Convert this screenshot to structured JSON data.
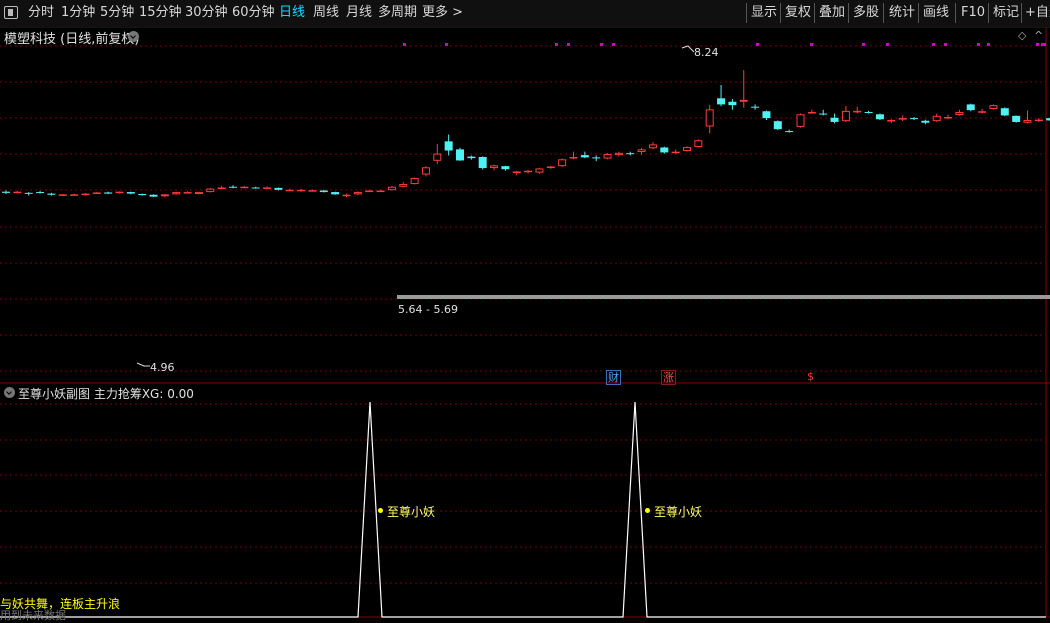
{
  "toolbar": {
    "periods": [
      {
        "label": "分时",
        "active": false
      },
      {
        "label": "1分钟",
        "active": false
      },
      {
        "label": "5分钟",
        "active": false
      },
      {
        "label": "15分钟",
        "active": false
      },
      {
        "label": "30分钟",
        "active": false
      },
      {
        "label": "60分钟",
        "active": false
      },
      {
        "label": "日线",
        "active": true
      },
      {
        "label": "周线",
        "active": false
      },
      {
        "label": "月线",
        "active": false
      },
      {
        "label": "多周期",
        "active": false
      },
      {
        "label": "更多 >",
        "active": false
      }
    ],
    "tools": [
      "显示",
      "复权",
      "叠加",
      "多股",
      "统计",
      "画线",
      "F10",
      "标记",
      "+自选"
    ]
  },
  "chart": {
    "title": "模塑科技 (日线,前复权)",
    "high_label": "8.24",
    "low_label": "4.96",
    "range_label": "5.64 - 5.69",
    "badges": [
      {
        "text": "财",
        "color": "#4aa8ff"
      },
      {
        "text": "涨",
        "color": "#ff5050"
      },
      {
        "text": "$",
        "color": "#ff3030"
      }
    ],
    "colors": {
      "up": "#ff3b3b",
      "down": "#4ef2f2",
      "grid": "#7a0000",
      "signal": "#ffffff"
    },
    "candles_approx_price": [
      {
        "o": 5.05,
        "c": 5.02,
        "h": 5.08,
        "l": 4.99
      },
      {
        "o": 5.03,
        "c": 5.05,
        "h": 5.07,
        "l": 5.0
      },
      {
        "o": 5.02,
        "c": 5.0,
        "h": 5.04,
        "l": 4.95
      },
      {
        "o": 5.04,
        "c": 5.02,
        "h": 5.07,
        "l": 5.0
      },
      {
        "o": 5.0,
        "c": 4.97,
        "h": 5.02,
        "l": 4.95
      },
      {
        "o": 4.96,
        "c": 4.98,
        "h": 4.99,
        "l": 4.94
      },
      {
        "o": 4.97,
        "c": 4.98,
        "h": 5.0,
        "l": 4.96
      },
      {
        "o": 4.96,
        "c": 5.0,
        "h": 5.01,
        "l": 4.95
      },
      {
        "o": 5.01,
        "c": 5.03,
        "h": 5.04,
        "l": 4.99
      },
      {
        "o": 5.03,
        "c": 5.0,
        "h": 5.05,
        "l": 4.99
      },
      {
        "o": 5.01,
        "c": 5.05,
        "h": 5.06,
        "l": 5.0
      },
      {
        "o": 5.04,
        "c": 5.0,
        "h": 5.05,
        "l": 4.98
      },
      {
        "o": 4.99,
        "c": 4.96,
        "h": 5.0,
        "l": 4.95
      },
      {
        "o": 4.97,
        "c": 4.92,
        "h": 4.98,
        "l": 4.91
      },
      {
        "o": 4.93,
        "c": 4.98,
        "h": 4.99,
        "l": 4.9
      },
      {
        "o": 4.98,
        "c": 5.04,
        "h": 5.05,
        "l": 4.97
      },
      {
        "o": 5.02,
        "c": 5.04,
        "h": 5.06,
        "l": 5.01
      },
      {
        "o": 4.99,
        "c": 5.04,
        "h": 5.05,
        "l": 4.98
      },
      {
        "o": 5.04,
        "c": 5.13,
        "h": 5.15,
        "l": 5.03
      },
      {
        "o": 5.13,
        "c": 5.16,
        "h": 5.2,
        "l": 5.12
      },
      {
        "o": 5.18,
        "c": 5.16,
        "h": 5.22,
        "l": 5.14
      },
      {
        "o": 5.15,
        "c": 5.18,
        "h": 5.2,
        "l": 5.14
      },
      {
        "o": 5.16,
        "c": 5.14,
        "h": 5.18,
        "l": 5.13
      },
      {
        "o": 5.13,
        "c": 5.16,
        "h": 5.19,
        "l": 5.12
      },
      {
        "o": 5.15,
        "c": 5.1,
        "h": 5.16,
        "l": 5.08
      },
      {
        "o": 5.09,
        "c": 5.1,
        "h": 5.13,
        "l": 5.07
      },
      {
        "o": 5.1,
        "c": 5.1,
        "h": 5.13,
        "l": 5.05
      },
      {
        "o": 5.07,
        "c": 5.09,
        "h": 5.11,
        "l": 5.05
      },
      {
        "o": 5.08,
        "c": 5.04,
        "h": 5.1,
        "l": 5.03
      },
      {
        "o": 5.04,
        "c": 4.98,
        "h": 5.05,
        "l": 4.97
      },
      {
        "o": 4.97,
        "c": 4.97,
        "h": 5.0,
        "l": 4.9
      },
      {
        "o": 4.98,
        "c": 5.04,
        "h": 5.06,
        "l": 4.96
      },
      {
        "o": 5.06,
        "c": 5.08,
        "h": 5.1,
        "l": 5.05
      },
      {
        "o": 5.07,
        "c": 5.08,
        "h": 5.1,
        "l": 5.06
      },
      {
        "o": 5.09,
        "c": 5.18,
        "h": 5.2,
        "l": 5.08
      },
      {
        "o": 5.18,
        "c": 5.25,
        "h": 5.3,
        "l": 5.17
      },
      {
        "o": 5.25,
        "c": 5.41,
        "h": 5.42,
        "l": 5.24
      },
      {
        "o": 5.5,
        "c": 5.69,
        "h": 5.72,
        "l": 5.45
      },
      {
        "o": 5.86,
        "c": 6.05,
        "h": 6.3,
        "l": 5.78
      },
      {
        "o": 6.37,
        "c": 6.13,
        "h": 6.55,
        "l": 6.0
      },
      {
        "o": 6.16,
        "c": 5.87,
        "h": 6.2,
        "l": 5.86
      },
      {
        "o": 5.97,
        "c": 5.93,
        "h": 6.0,
        "l": 5.89
      },
      {
        "o": 5.96,
        "c": 5.67,
        "h": 5.98,
        "l": 5.63
      },
      {
        "o": 5.67,
        "c": 5.74,
        "h": 5.76,
        "l": 5.61
      },
      {
        "o": 5.72,
        "c": 5.64,
        "h": 5.73,
        "l": 5.6
      },
      {
        "o": 5.54,
        "c": 5.58,
        "h": 5.59,
        "l": 5.48
      },
      {
        "o": 5.56,
        "c": 5.6,
        "h": 5.62,
        "l": 5.53
      },
      {
        "o": 5.55,
        "c": 5.66,
        "h": 5.68,
        "l": 5.52
      },
      {
        "o": 5.69,
        "c": 5.71,
        "h": 5.73,
        "l": 5.65
      },
      {
        "o": 5.72,
        "c": 5.9,
        "h": 5.92,
        "l": 5.7
      },
      {
        "o": 5.92,
        "c": 5.96,
        "h": 6.1,
        "l": 5.9
      },
      {
        "o": 6.01,
        "c": 5.95,
        "h": 6.1,
        "l": 5.93
      },
      {
        "o": 5.95,
        "c": 5.93,
        "h": 6.0,
        "l": 5.85
      },
      {
        "o": 5.92,
        "c": 6.04,
        "h": 6.06,
        "l": 5.9
      },
      {
        "o": 6.01,
        "c": 6.07,
        "h": 6.1,
        "l": 5.98
      },
      {
        "o": 6.06,
        "c": 6.04,
        "h": 6.1,
        "l": 6.0
      },
      {
        "o": 6.09,
        "c": 6.16,
        "h": 6.2,
        "l": 6.02
      },
      {
        "o": 6.19,
        "c": 6.29,
        "h": 6.35,
        "l": 6.17
      },
      {
        "o": 6.21,
        "c": 6.08,
        "h": 6.23,
        "l": 6.05
      },
      {
        "o": 6.08,
        "c": 6.1,
        "h": 6.15,
        "l": 6.05
      },
      {
        "o": 6.12,
        "c": 6.22,
        "h": 6.24,
        "l": 6.1
      },
      {
        "o": 6.22,
        "c": 6.4,
        "h": 6.42,
        "l": 6.21
      },
      {
        "o": 6.76,
        "c": 7.21,
        "h": 7.33,
        "l": 6.58
      },
      {
        "o": 7.5,
        "c": 7.34,
        "h": 7.85,
        "l": 7.29
      },
      {
        "o": 7.41,
        "c": 7.32,
        "h": 7.48,
        "l": 7.2
      },
      {
        "o": 7.41,
        "c": 7.46,
        "h": 8.24,
        "l": 7.25
      },
      {
        "o": 7.28,
        "c": 7.26,
        "h": 7.34,
        "l": 7.2
      },
      {
        "o": 7.16,
        "c": 6.98,
        "h": 7.18,
        "l": 6.93
      },
      {
        "o": 6.9,
        "c": 6.69,
        "h": 6.92,
        "l": 6.67
      },
      {
        "o": 6.64,
        "c": 6.63,
        "h": 6.68,
        "l": 6.6
      },
      {
        "o": 6.75,
        "c": 7.08,
        "h": 7.1,
        "l": 6.73
      },
      {
        "o": 7.13,
        "c": 7.14,
        "h": 7.2,
        "l": 7.1
      },
      {
        "o": 7.1,
        "c": 7.09,
        "h": 7.2,
        "l": 7.05
      },
      {
        "o": 6.99,
        "c": 6.88,
        "h": 7.1,
        "l": 6.84
      },
      {
        "o": 6.9,
        "c": 7.17,
        "h": 7.3,
        "l": 6.88
      },
      {
        "o": 7.13,
        "c": 7.17,
        "h": 7.28,
        "l": 7.1
      },
      {
        "o": 7.14,
        "c": 7.12,
        "h": 7.17,
        "l": 7.1
      },
      {
        "o": 7.08,
        "c": 6.95,
        "h": 7.1,
        "l": 6.93
      },
      {
        "o": 6.91,
        "c": 6.93,
        "h": 6.95,
        "l": 6.85
      },
      {
        "o": 6.95,
        "c": 6.98,
        "h": 7.05,
        "l": 6.9
      },
      {
        "o": 6.98,
        "c": 6.96,
        "h": 7.01,
        "l": 6.93
      },
      {
        "o": 6.91,
        "c": 6.86,
        "h": 6.94,
        "l": 6.82
      },
      {
        "o": 6.9,
        "c": 7.04,
        "h": 7.1,
        "l": 6.88
      },
      {
        "o": 6.98,
        "c": 7.01,
        "h": 7.07,
        "l": 6.95
      },
      {
        "o": 7.06,
        "c": 7.14,
        "h": 7.2,
        "l": 7.04
      },
      {
        "o": 7.34,
        "c": 7.19,
        "h": 7.36,
        "l": 7.16
      },
      {
        "o": 7.15,
        "c": 7.16,
        "h": 7.22,
        "l": 7.1
      },
      {
        "o": 7.22,
        "c": 7.32,
        "h": 7.34,
        "l": 7.2
      },
      {
        "o": 7.24,
        "c": 7.05,
        "h": 7.26,
        "l": 7.03
      },
      {
        "o": 7.04,
        "c": 6.88,
        "h": 7.05,
        "l": 6.86
      },
      {
        "o": 6.86,
        "c": 6.93,
        "h": 7.18,
        "l": 6.84
      },
      {
        "o": 6.91,
        "c": 6.94,
        "h": 6.98,
        "l": 6.88
      },
      {
        "o": 6.98,
        "c": 6.92,
        "h": 7.0,
        "l": 6.9
      },
      {
        "o": 6.94,
        "c": 6.7,
        "h": 6.96,
        "l": 6.68
      },
      {
        "o": 6.75,
        "c": 6.75,
        "h": 6.81,
        "l": 6.7
      }
    ],
    "top_marker_count": 17
  },
  "subchart": {
    "title": "至尊小妖副图  主力抢筹XG: 0.00",
    "signal_labels": [
      "至尊小妖",
      "至尊小妖"
    ],
    "bottom_text": "与妖共舞，连板主升浪",
    "bottom_text2": "用到未来数据"
  }
}
